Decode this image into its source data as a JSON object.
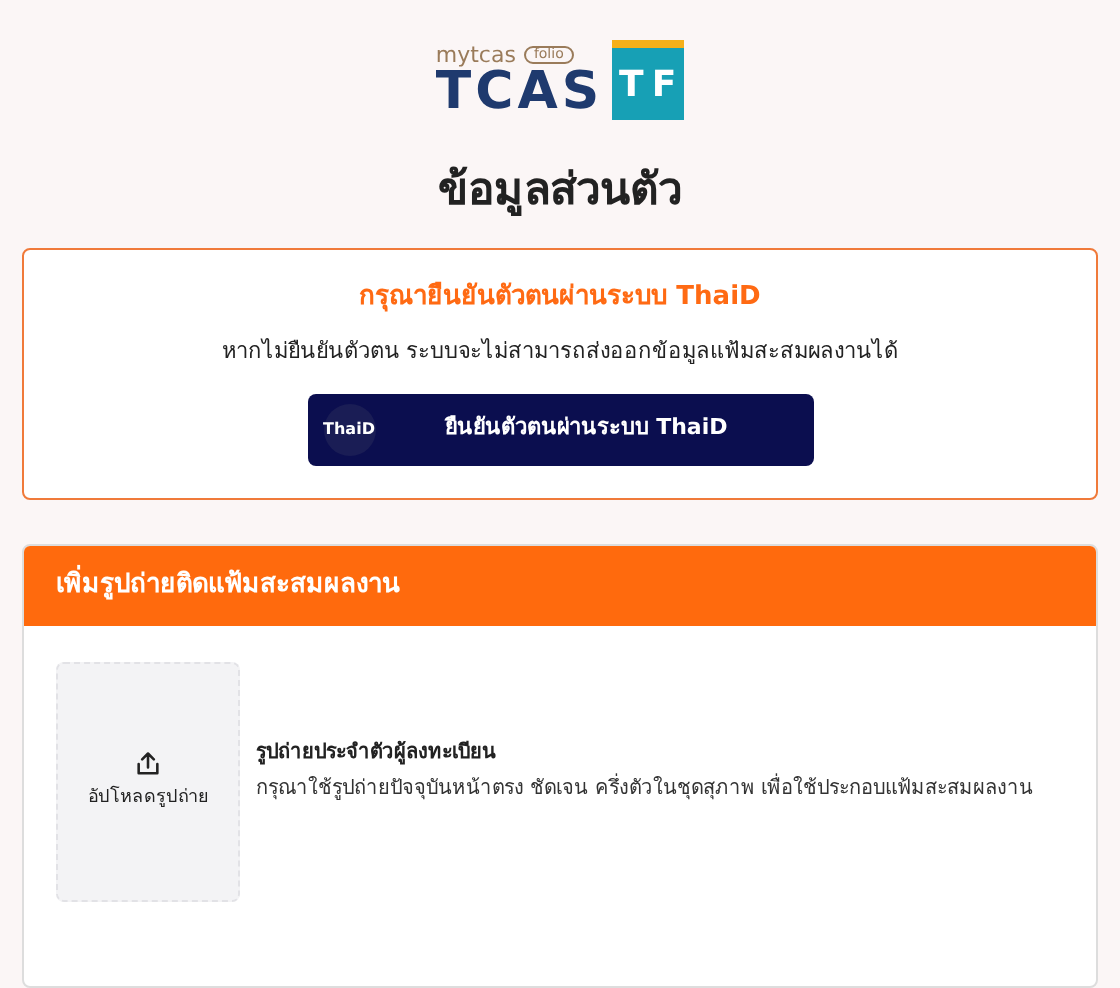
{
  "logo": {
    "brand": "mytcas",
    "tag": "folio",
    "name": "TCAS",
    "letters": [
      "T",
      "F"
    ]
  },
  "title": "ข้อมูลส่วนตัว",
  "verify_card": {
    "heading": "กรุณายืนยันตัวตนผ่านระบบ ThaiD",
    "message": "หากไม่ยืนยันตัวตน ระบบจะไม่สามารถส่งออกข้อมูลแฟ้มสะสมผลงานได้",
    "button": {
      "badge": "ThaiD",
      "label": "ยืนยันตัวตนผ่านระบบ ThaiD"
    }
  },
  "photo_card": {
    "header": "เพิ่มรูปถ่ายติดแฟ้มสะสมผลงาน",
    "upload_label": "อัปโหลดรูปถ่าย",
    "photo_title": "รูปถ่ายประจำตัวผู้ลงทะเบียน",
    "photo_hint": "กรุณาใช้รูปถ่ายปัจจุบันหน้าตรง ชัดเจน ครึ่งตัวในชุดสุภาพ เพื่อใช้ประกอบแฟ้มสะสมผลงาน"
  }
}
